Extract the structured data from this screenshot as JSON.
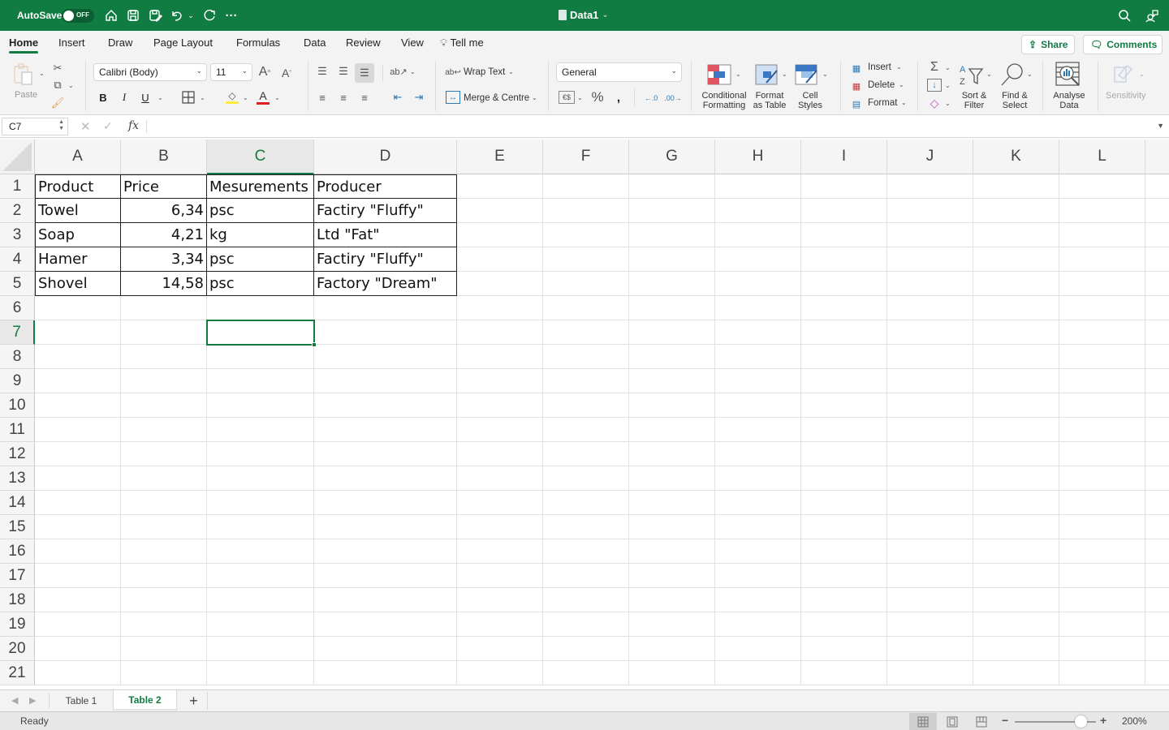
{
  "titlebar": {
    "autosave_label": "AutoSave",
    "autosave_state": "OFF",
    "doc_title": "Data1",
    "colors": {
      "brand": "#107c41"
    }
  },
  "menu": {
    "tabs": [
      {
        "label": "Home",
        "active": true
      },
      {
        "label": "Insert"
      },
      {
        "label": "Draw"
      },
      {
        "label": "Page Layout"
      },
      {
        "label": "Formulas"
      },
      {
        "label": "Data"
      },
      {
        "label": "Review"
      },
      {
        "label": "View"
      }
    ],
    "tell_me": "Tell me",
    "share": "Share",
    "comments": "Comments"
  },
  "ribbon": {
    "paste": "Paste",
    "font_name": "Calibri (Body)",
    "font_size": "11",
    "bold": "B",
    "italic": "I",
    "underline": "U",
    "wrap_text": "Wrap Text",
    "merge_centre": "Merge & Centre",
    "number_format": "General",
    "percent": "%",
    "comma": "9",
    "conditional_formatting": [
      "Conditional",
      "Formatting"
    ],
    "format_as_table": [
      "Format",
      "as Table"
    ],
    "cell_styles": [
      "Cell",
      "Styles"
    ],
    "insert": "Insert",
    "delete": "Delete",
    "format": "Format",
    "sort_filter": [
      "Sort &",
      "Filter"
    ],
    "find_select": [
      "Find &",
      "Select"
    ],
    "analyse_data": [
      "Analyse",
      "Data"
    ],
    "sensitivity": "Sensitivity"
  },
  "formula_bar": {
    "name_box": "C7",
    "fx": "fx",
    "content": ""
  },
  "grid": {
    "columns": [
      "A",
      "B",
      "C",
      "D",
      "E",
      "F",
      "G",
      "H",
      "I",
      "J",
      "K",
      "L"
    ],
    "rows": [
      "1",
      "2",
      "3",
      "4",
      "5",
      "6",
      "7",
      "8",
      "9",
      "10",
      "11",
      "12",
      "13",
      "14",
      "15",
      "16",
      "17",
      "18",
      "19",
      "20",
      "21"
    ],
    "selected_cell": "C7",
    "table": [
      [
        "Product",
        "Price",
        "Mesurements",
        "Producer"
      ],
      [
        "Towel",
        "6,34",
        "psc",
        "Factiry \"Fluffy\""
      ],
      [
        "Soap",
        "4,21",
        "kg",
        "Ltd \"Fat\""
      ],
      [
        "Hamer",
        "3,34",
        "psc",
        "Factiry \"Fluffy\""
      ],
      [
        "Shovel",
        "14,58",
        "psc",
        "Factory \"Dream\""
      ]
    ]
  },
  "sheets": {
    "tabs": [
      {
        "label": "Table 1"
      },
      {
        "label": "Table 2",
        "active": true
      }
    ],
    "add": "+"
  },
  "status": {
    "text": "Ready",
    "zoom_percent": "200%",
    "zoom_level": 200
  }
}
